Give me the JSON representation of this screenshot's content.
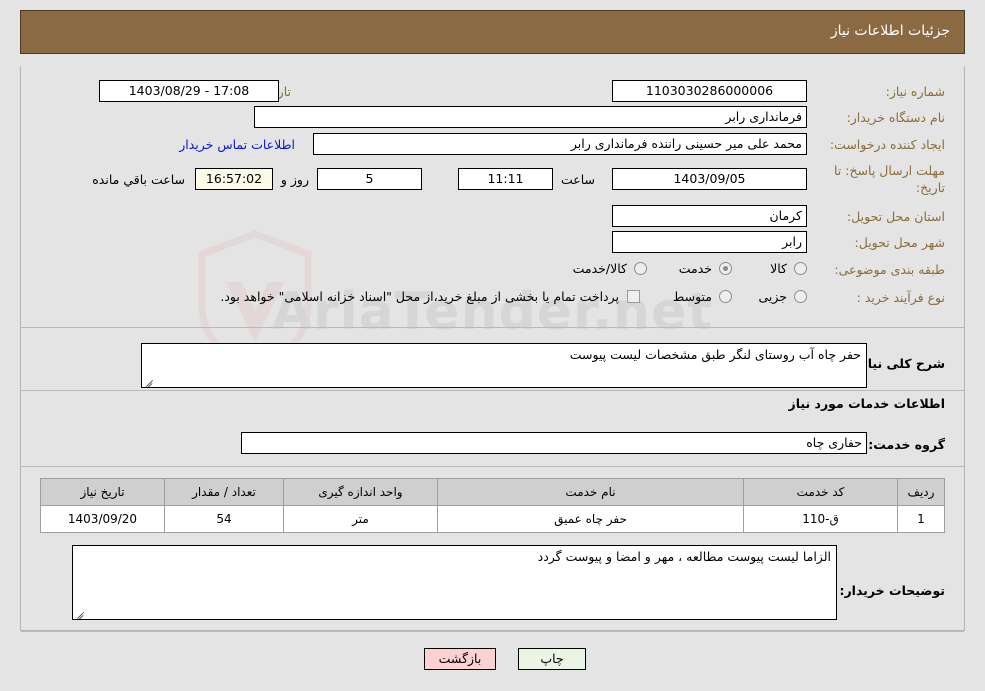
{
  "header": {
    "title": "جزئیات اطلاعات نیاز"
  },
  "watermark": {
    "text": "AriaTender.net",
    "icon": "shield-icon"
  },
  "summary": {
    "need_number_label": "شماره نیاز:",
    "need_number_value": "1103030286000006",
    "public_announce_label": "تاریخ و ساعت اعلان عمومی:",
    "public_announce_value": "17:08 - 1403/08/29",
    "buyer_org_label": "نام دستگاه خریدار:",
    "buyer_org_value": "فرمانداری رابر",
    "requester_label": "ایجاد کننده درخواست:",
    "requester_value": "محمد علی  میر حسینی راننده فرمانداری رابر",
    "buyer_contact_link": "اطلاعات تماس خریدار",
    "deadline_label": "مهلت ارسال پاسخ: تا تاریخ:",
    "deadline_date": "1403/09/05",
    "hour_label": "ساعت",
    "deadline_time": "11:11",
    "remaining_days": "5",
    "days_and_label": "روز و",
    "remaining_clock": "16:57:02",
    "remaining_suffix": "ساعت باقي مانده",
    "province_label": "استان محل تحویل:",
    "province_value": "کرمان",
    "city_label": "شهر محل تحویل:",
    "city_value": "رابر",
    "category_label": "طبقه بندی موضوعی:",
    "category_options": [
      {
        "label": "کالا",
        "selected": false
      },
      {
        "label": "خدمت",
        "selected": true
      },
      {
        "label": "کالا/خدمت",
        "selected": false
      }
    ],
    "process_label": "نوع فرآیند خرید :",
    "process_options": [
      {
        "label": "جزیی",
        "selected": false
      },
      {
        "label": "متوسط",
        "selected": false
      }
    ],
    "treasury_checkbox_label": "پرداخت تمام یا بخشی از مبلغ خرید،از محل \"اسناد خزانه اسلامی\" خواهد بود."
  },
  "description": {
    "label": "شرح کلی نیاز:",
    "value": "حفر چاه آب روستای لنگر طبق مشخصات لیست پیوست"
  },
  "services_section": {
    "heading": "اطلاعات خدمات مورد نیاز",
    "group_label": "گروه خدمت:",
    "group_value": "حفاری چاه"
  },
  "table": {
    "columns": [
      "ردیف",
      "کد خدمت",
      "نام خدمت",
      "واحد اندازه گیری",
      "تعداد / مقدار",
      "تاریخ نیاز"
    ],
    "rows": [
      {
        "row_no": "1",
        "service_code": "ق-110",
        "service_name": "حفر چاه عمیق",
        "unit": "متر",
        "quantity": "54",
        "need_date": "1403/09/20"
      }
    ]
  },
  "buyer_notes": {
    "label": "توضیحات خریدار:",
    "value": "الزاما لیست پیوست مطالعه ، مهر و امضا و پیوست گردد"
  },
  "footer": {
    "print_label": "چاپ",
    "back_label": "بازگشت"
  },
  "colors": {
    "header_bg": "#8b6a43",
    "label": "#8a6d3b",
    "link": "#0b15d6",
    "page_bg": "#e4e4e4",
    "table_header_bg": "#cfcfcf",
    "print_btn_bg": "#e8f6e3",
    "back_btn_bg": "#fbd1d1"
  }
}
